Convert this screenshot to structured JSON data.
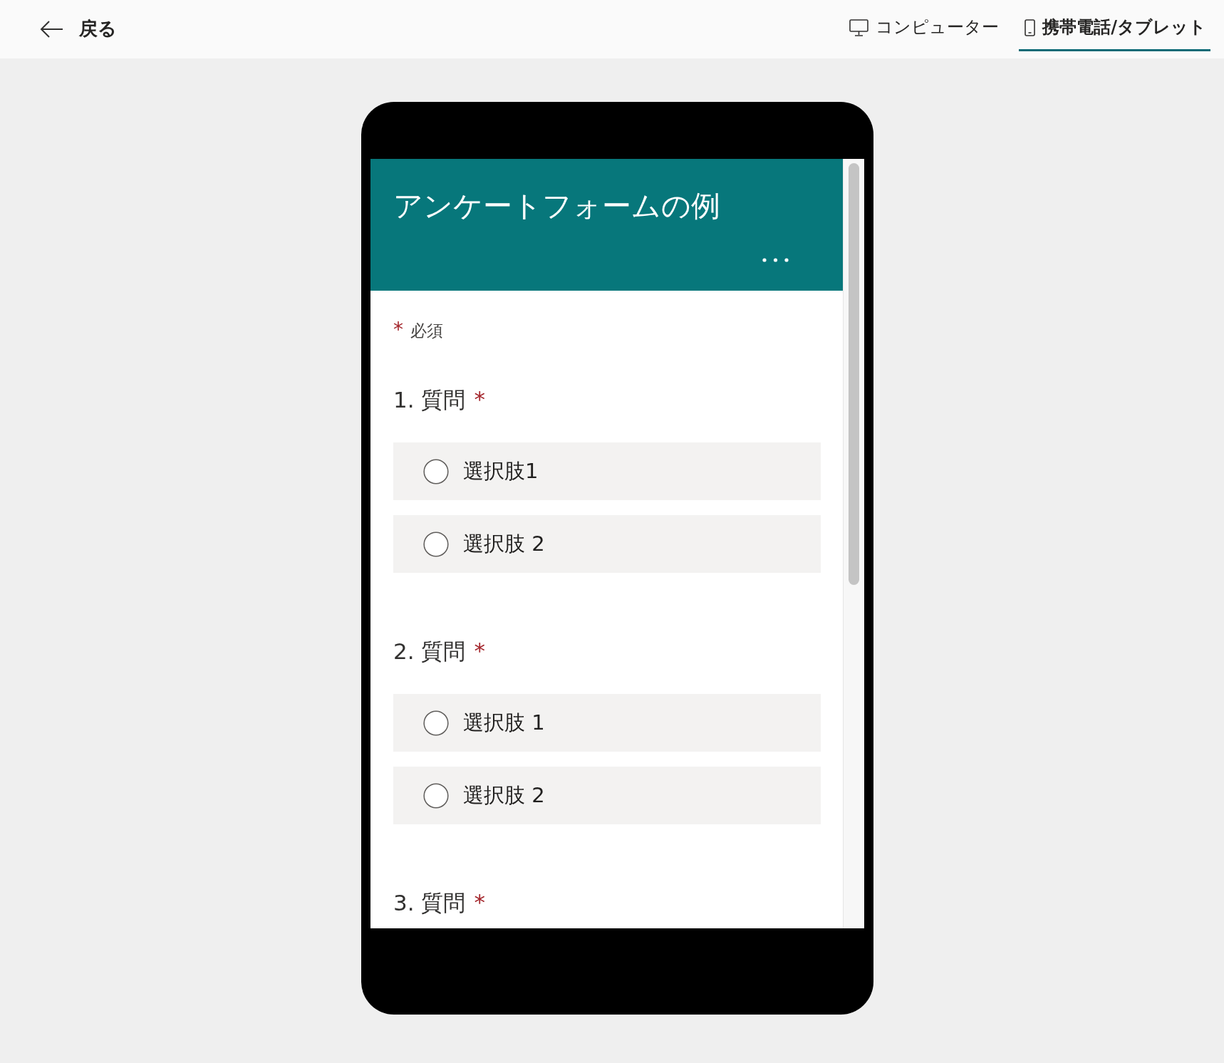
{
  "top_bar": {
    "back_button": {
      "label": "戻る"
    },
    "view_tabs": [
      {
        "kind": "computer",
        "label": "コンピューター",
        "selected": false
      },
      {
        "kind": "phone",
        "label": "携帯電話/タブレット",
        "selected": true
      }
    ]
  },
  "form": {
    "title": "アンケートフォームの例",
    "required_note": {
      "mark": "*",
      "label": "必須"
    },
    "questions": [
      {
        "title": "1. 質問",
        "required_mark": "*",
        "options": [
          {
            "label": "選択肢1",
            "selected": false
          },
          {
            "label": "選択肢 2",
            "selected": false
          }
        ]
      },
      {
        "title": "2. 質問",
        "required_mark": "*",
        "options": [
          {
            "label": "選択肢 1",
            "selected": false
          },
          {
            "label": "選択肢 2",
            "selected": false
          }
        ]
      },
      {
        "title": "3. 質問",
        "required_mark": "*"
      }
    ]
  }
}
